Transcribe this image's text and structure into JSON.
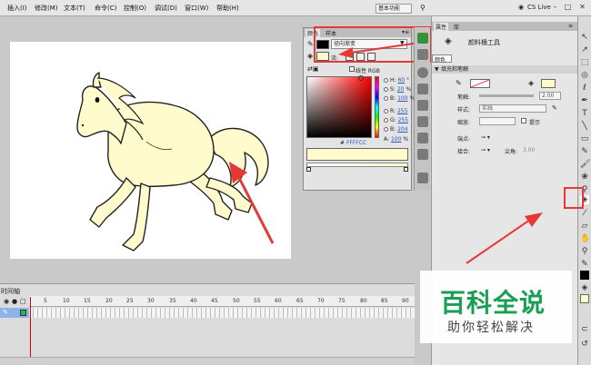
{
  "menubar": {
    "items": [
      {
        "label": "插入(I)"
      },
      {
        "label": "修改(M)"
      },
      {
        "label": "文本(T)"
      },
      {
        "label": "命令(C)"
      },
      {
        "label": "控制(O)"
      },
      {
        "label": "调试(D)"
      },
      {
        "label": "窗口(W)"
      },
      {
        "label": "帮助(H)"
      }
    ],
    "workspace": "基本功能",
    "cs_live": "CS Live"
  },
  "timeline": {
    "title": "时间轴",
    "ticks": [
      "5",
      "10",
      "15",
      "20",
      "25",
      "30",
      "35",
      "40",
      "45",
      "50",
      "55",
      "60",
      "65",
      "70",
      "75",
      "80",
      "85",
      "90"
    ]
  },
  "color_panel": {
    "tabs": [
      "颜色",
      "样本"
    ],
    "type_select": "径向渐变",
    "flow_label": "流:",
    "linear_label": "线性 RGB",
    "hsb": [
      {
        "label": "H:",
        "value": "60",
        "unit": "°"
      },
      {
        "label": "S:",
        "value": "20",
        "unit": "%"
      },
      {
        "label": "B:",
        "value": "100",
        "unit": "%"
      },
      {
        "label": "R:",
        "value": "255",
        "unit": ""
      },
      {
        "label": "G:",
        "value": "255",
        "unit": ""
      },
      {
        "label": "B:",
        "value": "204",
        "unit": ""
      },
      {
        "label": "A:",
        "value": "100",
        "unit": "%"
      }
    ],
    "hex": "FFFFCC",
    "fill_color": "#fffbcc"
  },
  "properties": {
    "tabs": [
      "属性",
      "库"
    ],
    "tool_name": "颜料桶工具",
    "sub_tab": "颜色",
    "section": "填充和笔触",
    "stroke_label": "笔触:",
    "stroke_value": "2.00",
    "style_label": "样式:",
    "style_value": "实线",
    "scale_label": "缩放:",
    "hint_label": "提示",
    "cap_label": "端点:",
    "join_label": "接合:",
    "miter_label": "尖角:",
    "miter_value": "3.00"
  },
  "watermark": {
    "title": "百科全说",
    "subtitle": "助你轻松解决"
  }
}
